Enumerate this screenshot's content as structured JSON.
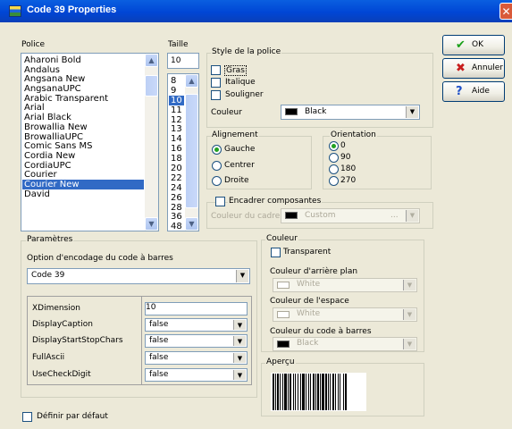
{
  "window": {
    "title": "Code 39 Properties",
    "close_glyph": "✕"
  },
  "police": {
    "label": "Police",
    "fonts": [
      "Aharoni Bold",
      "Andalus",
      "Angsana New",
      "AngsanaUPC",
      "Arabic Transparent",
      "Arial",
      "Arial Black",
      "Browallia New",
      "BrowalliaUPC",
      "Comic Sans MS",
      "Cordia New",
      "CordiaUPC",
      "Courier",
      "Courier New",
      "David"
    ],
    "selected": "Courier New"
  },
  "taille": {
    "label": "Taille",
    "value": "10",
    "sizes": [
      "8",
      "9",
      "10",
      "11",
      "12",
      "13",
      "14",
      "16",
      "18",
      "20",
      "22",
      "24",
      "26",
      "28",
      "36",
      "48"
    ],
    "selected": "10"
  },
  "style": {
    "group_label": "Style de la police",
    "bold": {
      "label": "Gras",
      "checked": false
    },
    "italic": {
      "label": "Italique",
      "checked": false
    },
    "underline": {
      "label": "Souligner",
      "checked": false
    },
    "color_label": "Couleur",
    "color_value": "Black",
    "color_hex": "#000000"
  },
  "alignement": {
    "group_label": "Alignement",
    "options": [
      "Gauche",
      "Centrer",
      "Droite"
    ],
    "selected": "Gauche"
  },
  "orientation": {
    "group_label": "Orientation",
    "options": [
      "0",
      "90",
      "180",
      "270"
    ],
    "selected": "0"
  },
  "frame": {
    "checkbox_label": "Encadrer composantes",
    "checked": false,
    "color_label": "Couleur du cadre",
    "color_value": "Custom",
    "ellipsis": "..."
  },
  "buttons": {
    "ok": "OK",
    "cancel": "Annuler",
    "help": "Aide"
  },
  "parametres": {
    "group_label": "Paramètres",
    "encoding_label": "Option d'encodage du code à barres",
    "encoding_value": "Code 39",
    "rows": [
      {
        "name": "XDimension",
        "value": "10",
        "type": "text"
      },
      {
        "name": "DisplayCaption",
        "value": "false",
        "type": "combo"
      },
      {
        "name": "DisplayStartStopChars",
        "value": "false",
        "type": "combo"
      },
      {
        "name": "FullAscii",
        "value": "false",
        "type": "combo"
      },
      {
        "name": "UseCheckDigit",
        "value": "false",
        "type": "combo"
      }
    ]
  },
  "couleur": {
    "group_label": "Couleur",
    "transparent_label": "Transparent",
    "transparent_checked": false,
    "bg_label": "Couleur d'arrière plan",
    "bg_value": "White",
    "bg_hex": "#FFFFFF",
    "space_label": "Couleur de l'espace",
    "space_value": "White",
    "space_hex": "#FFFFFF",
    "bar_label": "Couleur du code à barres",
    "bar_value": "Black",
    "bar_hex": "#000000"
  },
  "apercu": {
    "group_label": "Aperçu"
  },
  "default": {
    "label": "Définir par défaut",
    "checked": false
  }
}
